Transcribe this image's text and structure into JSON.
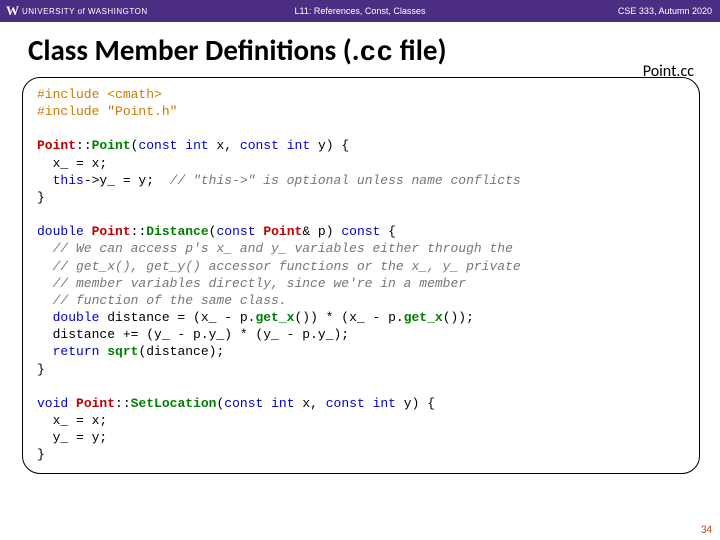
{
  "topbar": {
    "logo_w": "W",
    "logo_text": "UNIVERSITY of WASHINGTON",
    "lecture": "L11: References, Const, Classes",
    "course": "CSE 333, Autumn 2020"
  },
  "title": {
    "prefix": "Class Member Definitions (.",
    "mono": "cc",
    "suffix": " file)"
  },
  "filename": "Point.cc",
  "code": {
    "l01a": "#include",
    "l01b": " <cmath>",
    "l02a": "#include",
    "l02b": " \"Point.h\"",
    "blank1": "",
    "l03a": "Point",
    "l03b": "::",
    "l03c": "Point",
    "l03d": "(",
    "l03e": "const",
    "l03f": " ",
    "l03g": "int",
    "l03h": " x, ",
    "l03i": "const",
    "l03j": " ",
    "l03k": "int",
    "l03l": " y) {",
    "l04": "  x_ = x;",
    "l05a": "  ",
    "l05b": "this",
    "l05c": "->y_ = y;  ",
    "l05d": "// \"this->\" is optional unless name conflicts",
    "l06": "}",
    "blank2": "",
    "l07a": "double",
    "l07b": " ",
    "l07c": "Point",
    "l07d": "::",
    "l07e": "Distance",
    "l07f": "(",
    "l07g": "const",
    "l07h": " ",
    "l07i": "Point",
    "l07j": "& p) ",
    "l07k": "const",
    "l07l": " {",
    "l08": "  // We can access p's x_ and y_ variables either through the",
    "l09": "  // get_x(), get_y() accessor functions or the x_, y_ private",
    "l10": "  // member variables directly, since we're in a member",
    "l11": "  // function of the same class.",
    "l12a": "  ",
    "l12b": "double",
    "l12c": " distance = (x_ - p.",
    "l12d": "get_x",
    "l12e": "()) * (x_ - p.",
    "l12f": "get_x",
    "l12g": "());",
    "l13": "  distance += (y_ - p.y_) * (y_ - p.y_);",
    "l14a": "  ",
    "l14b": "return",
    "l14c": " ",
    "l14d": "sqrt",
    "l14e": "(distance);",
    "l15": "}",
    "blank3": "",
    "l16a": "void",
    "l16b": " ",
    "l16c": "Point",
    "l16d": "::",
    "l16e": "SetLocation",
    "l16f": "(",
    "l16g": "const",
    "l16h": " ",
    "l16i": "int",
    "l16j": " x, ",
    "l16k": "const",
    "l16l": " ",
    "l16m": "int",
    "l16n": " y) {",
    "l17": "  x_ = x;",
    "l18": "  y_ = y;",
    "l19": "}"
  },
  "pagenum": "34"
}
